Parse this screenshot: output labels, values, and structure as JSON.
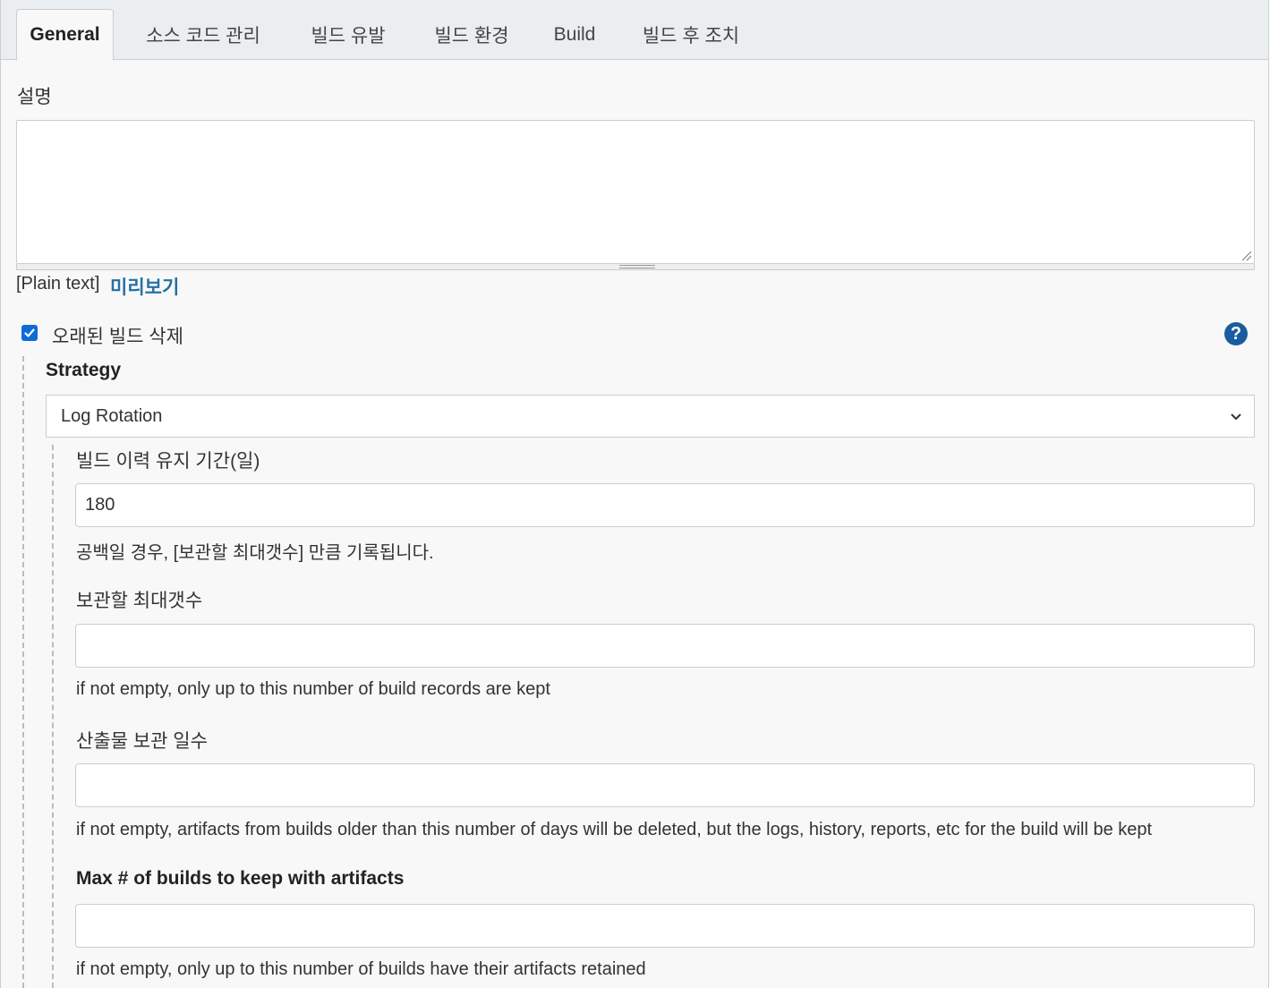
{
  "tabs": [
    {
      "label": "General",
      "active": true
    },
    {
      "label": "소스 코드 관리",
      "active": false
    },
    {
      "label": "빌드 유발",
      "active": false
    },
    {
      "label": "빌드 환경",
      "active": false
    },
    {
      "label": "Build",
      "active": false
    },
    {
      "label": "빌드 후 조치",
      "active": false
    }
  ],
  "description": {
    "label": "설명",
    "value": "",
    "format_label": "[Plain text]",
    "preview_link": "미리보기"
  },
  "discard_old_builds": {
    "label": "오래된 빌드 삭제",
    "checked": true,
    "help_icon": "question-circle-icon",
    "strategy": {
      "label": "Strategy",
      "selected": "Log Rotation"
    },
    "fields": [
      {
        "label": "빌드 이력 유지 기간(일)",
        "value": "180",
        "hint": "공백일 경우, [보관할 최대갯수] 만큼 기록됩니다."
      },
      {
        "label": "보관할 최대갯수",
        "value": "",
        "hint": "if not empty, only up to this number of build records are kept"
      },
      {
        "label": "산출물 보관 일수",
        "value": "",
        "hint": "if not empty, artifacts from builds older than this number of days will be deleted, but the logs, history, reports, etc for the build will be kept"
      },
      {
        "label": "Max # of builds to keep with artifacts",
        "value": "",
        "hint": "if not empty, only up to this number of builds have their artifacts retained"
      }
    ]
  },
  "colors": {
    "accent": "#0b6cd8",
    "link": "#2471a3",
    "help": "#1a5d9e",
    "tabbar_bg": "#eaeef1",
    "page_bg": "#f8f8f8"
  }
}
